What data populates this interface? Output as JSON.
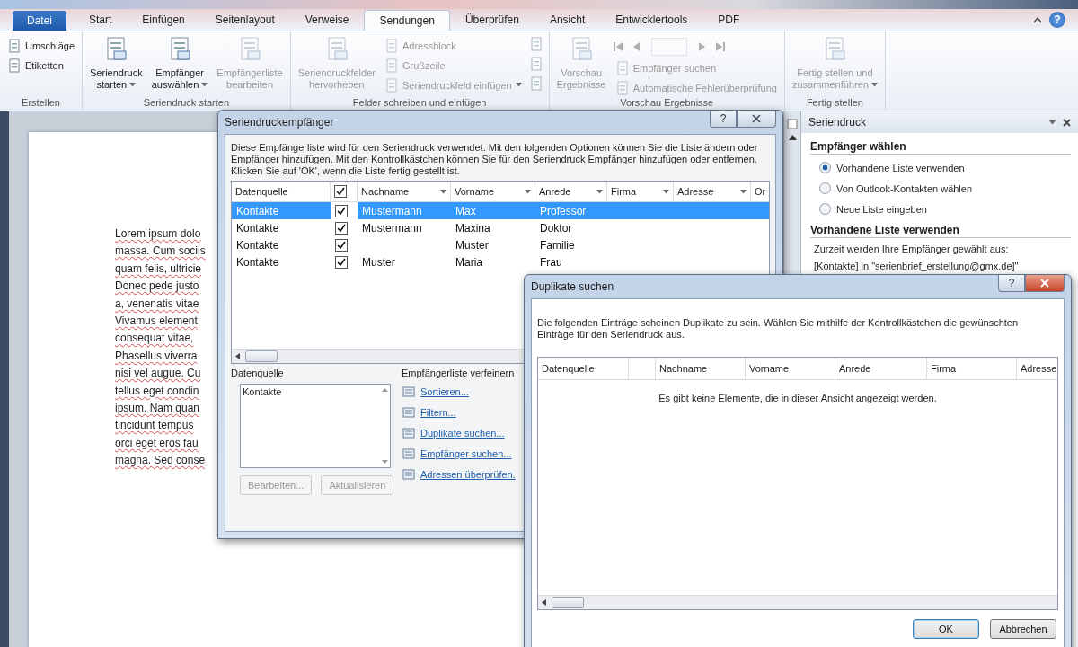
{
  "ribbon_tabs": [
    {
      "label": "Datei",
      "kind": "file",
      "selected": false
    },
    {
      "label": "Start",
      "kind": "tab",
      "selected": false
    },
    {
      "label": "Einfügen",
      "kind": "tab",
      "selected": false
    },
    {
      "label": "Seitenlayout",
      "kind": "tab",
      "selected": false
    },
    {
      "label": "Verweise",
      "kind": "tab",
      "selected": false
    },
    {
      "label": "Sendungen",
      "kind": "tab",
      "selected": true
    },
    {
      "label": "Überprüfen",
      "kind": "tab",
      "selected": false
    },
    {
      "label": "Ansicht",
      "kind": "tab",
      "selected": false
    },
    {
      "label": "Entwicklertools",
      "kind": "tab",
      "selected": false
    },
    {
      "label": "PDF",
      "kind": "tab",
      "selected": false
    }
  ],
  "ribbon_help": "?",
  "ribbon_groups": [
    {
      "label": "Erstellen",
      "columns": [
        {
          "kind": "stack",
          "items": [
            {
              "label": "Umschläge",
              "disabled": false,
              "dropdown": false
            },
            {
              "label": "Etiketten",
              "disabled": false,
              "dropdown": false
            }
          ]
        }
      ]
    },
    {
      "label": "Seriendruck starten",
      "columns": [
        {
          "kind": "large",
          "lines": [
            "Seriendruck",
            "starten"
          ],
          "disabled": false,
          "dropdown": true
        },
        {
          "kind": "large",
          "lines": [
            "Empfänger",
            "auswählen"
          ],
          "disabled": false,
          "dropdown": true
        },
        {
          "kind": "large",
          "lines": [
            "Empfängerliste",
            "bearbeiten"
          ],
          "disabled": true,
          "dropdown": false
        }
      ]
    },
    {
      "label": "Felder schreiben und einfügen",
      "columns": [
        {
          "kind": "large",
          "lines": [
            "Seriendruckfelder",
            "hervorheben"
          ],
          "disabled": true,
          "dropdown": false
        },
        {
          "kind": "stack",
          "items": [
            {
              "label": "Adressblock",
              "disabled": true,
              "dropdown": false
            },
            {
              "label": "Grußzeile",
              "disabled": true,
              "dropdown": false
            },
            {
              "label": "Seriendruckfeld einfügen",
              "disabled": true,
              "dropdown": true
            }
          ]
        },
        {
          "kind": "icons",
          "disabled": true
        }
      ]
    },
    {
      "label": "Vorschau Ergebnisse",
      "columns": [
        {
          "kind": "large",
          "lines": [
            "Vorschau",
            "Ergebnisse"
          ],
          "disabled": true,
          "dropdown": false
        },
        {
          "kind": "nav",
          "disabled": true,
          "items": [
            {
              "label": "Empfänger suchen",
              "disabled": true,
              "dropdown": false
            },
            {
              "label": "Automatische Fehlerüberprüfung",
              "disabled": true,
              "dropdown": false
            }
          ]
        }
      ]
    },
    {
      "label": "Fertig stellen",
      "columns": [
        {
          "kind": "large",
          "lines": [
            "Fertig stellen und",
            "zusammenführen"
          ],
          "disabled": true,
          "dropdown": true
        }
      ]
    }
  ],
  "document": {
    "lines": [
      "Lorem ipsum dolo",
      "massa. Cum sociis",
      "quam felis, ultricie",
      "Donec pede justo",
      "a, venenatis vitae",
      "Vivamus element",
      "consequat vitae,",
      "Phasellus viverra",
      "nisi vel augue. Cu",
      "tellus eget condin",
      "ipsum. Nam quan",
      "tincidunt tempus",
      "orci eget eros fau",
      "magna. Sed conse"
    ]
  },
  "task_pane": {
    "title": "Seriendruck",
    "sections": [
      {
        "heading": "Empfänger wählen",
        "options": [
          {
            "label": "Vorhandene Liste verwenden",
            "selected": true
          },
          {
            "label": "Von Outlook-Kontakten wählen",
            "selected": false
          },
          {
            "label": "Neue Liste eingeben",
            "selected": false
          }
        ]
      },
      {
        "heading": "Vorhandene Liste verwenden",
        "texts": [
          "Zurzeit werden Ihre Empfänger gewählt aus:",
          "[Kontakte] in \"serienbrief_erstellung@gmx.de]\""
        ]
      }
    ]
  },
  "recipients_dialog": {
    "title": "Seriendruckempfänger",
    "help": "?",
    "description": "Diese Empfängerliste wird für den Seriendruck verwendet. Mit den folgenden Optionen können Sie die Liste ändern oder Empfänger hinzufügen. Mit den Kontrollkästchen können Sie für den Seriendruck Empfänger hinzufügen oder entfernen. Klicken Sie auf 'OK', wenn die Liste fertig gestellt ist.",
    "columns": [
      {
        "kind": "text",
        "label": "Datenquelle",
        "filter": false
      },
      {
        "kind": "check",
        "checked": true
      },
      {
        "kind": "text",
        "label": "Nachname",
        "filter": true
      },
      {
        "kind": "text",
        "label": "Vorname",
        "filter": true
      },
      {
        "kind": "text",
        "label": "Anrede",
        "filter": true
      },
      {
        "kind": "text",
        "label": "Firma",
        "filter": true
      },
      {
        "kind": "text",
        "label": "Adresse",
        "filter": true
      },
      {
        "kind": "text",
        "label": "Or",
        "filter": false
      }
    ],
    "rows": [
      {
        "selected": true,
        "checked": true,
        "cells": [
          "Kontakte",
          "",
          "Mustermann",
          "Max",
          "Professor"
        ]
      },
      {
        "selected": false,
        "checked": true,
        "cells": [
          "Kontakte",
          "",
          "Mustermann",
          "Maxina",
          "Doktor"
        ]
      },
      {
        "selected": false,
        "checked": true,
        "cells": [
          "Kontakte",
          "",
          "",
          "Muster",
          "Familie"
        ]
      },
      {
        "selected": false,
        "checked": true,
        "cells": [
          "Kontakte",
          "",
          "Muster",
          "Maria",
          "Frau"
        ]
      }
    ],
    "source_label": "Datenquelle",
    "sources": [
      "Kontakte"
    ],
    "buttons": [
      {
        "label": "Bearbeiten...",
        "disabled": true
      },
      {
        "label": "Aktualisieren",
        "disabled": true
      }
    ],
    "refine_label": "Empfängerliste verfeinern",
    "refine_links": [
      "Sortieren...",
      "Filtern...",
      "Duplikate suchen...",
      "Empfänger suchen...",
      "Adressen überprüfen."
    ]
  },
  "duplicates_dialog": {
    "title": "Duplikate suchen",
    "help": "?",
    "description": "Die folgenden Einträge scheinen Duplikate zu sein. Wählen Sie mithilfe der Kontrollkästchen die gewünschten Einträge für den Seriendruck aus.",
    "columns": [
      "Datenquelle",
      "",
      "Nachname",
      "Vorname",
      "Anrede",
      "Firma",
      "Adresse"
    ],
    "empty_message": "Es gibt keine Elemente, die in dieser Ansicht angezeigt werden.",
    "buttons": [
      {
        "label": "OK",
        "default": true
      },
      {
        "label": "Abbrechen",
        "default": false
      }
    ]
  }
}
